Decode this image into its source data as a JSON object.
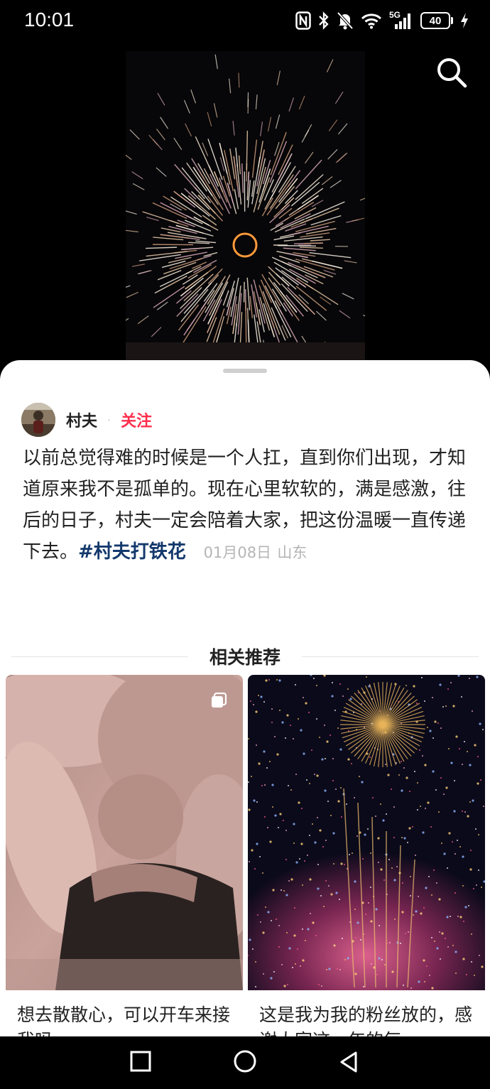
{
  "status_bar": {
    "time": "10:01",
    "battery": "40",
    "network": "5G",
    "icons": [
      "nfc-icon",
      "bluetooth-icon",
      "mute-icon",
      "wifi-icon",
      "signal-icon",
      "battery-icon",
      "charging-icon"
    ]
  },
  "video": {
    "search_icon": "search-icon"
  },
  "post": {
    "author": "村夫",
    "separator": "·",
    "follow_label": "关注",
    "text": "以前总觉得难的时候是一个人扛，直到你们出现，才知道原来我不是孤单的。现在心里软软的，满是感激，往后的日子，村夫一定会陪着大家，把这份温暖一直传递下去。",
    "hashtag": "#村夫打铁花",
    "date": "01月08日",
    "location": "山东"
  },
  "related": {
    "title": "相关推荐",
    "cards": [
      {
        "title": "想去散散心，可以开车来接我吗",
        "badge_icon": "multi-image-icon"
      },
      {
        "title": "这是我为我的粉丝放的，感谢大家这一年的每一"
      }
    ]
  },
  "nav": {
    "icons": [
      "recents-icon",
      "home-icon",
      "back-icon"
    ]
  },
  "colors": {
    "accent_follow": "#ff2e4d",
    "hashtag": "#13386c",
    "meta": "#b5b5b5"
  }
}
